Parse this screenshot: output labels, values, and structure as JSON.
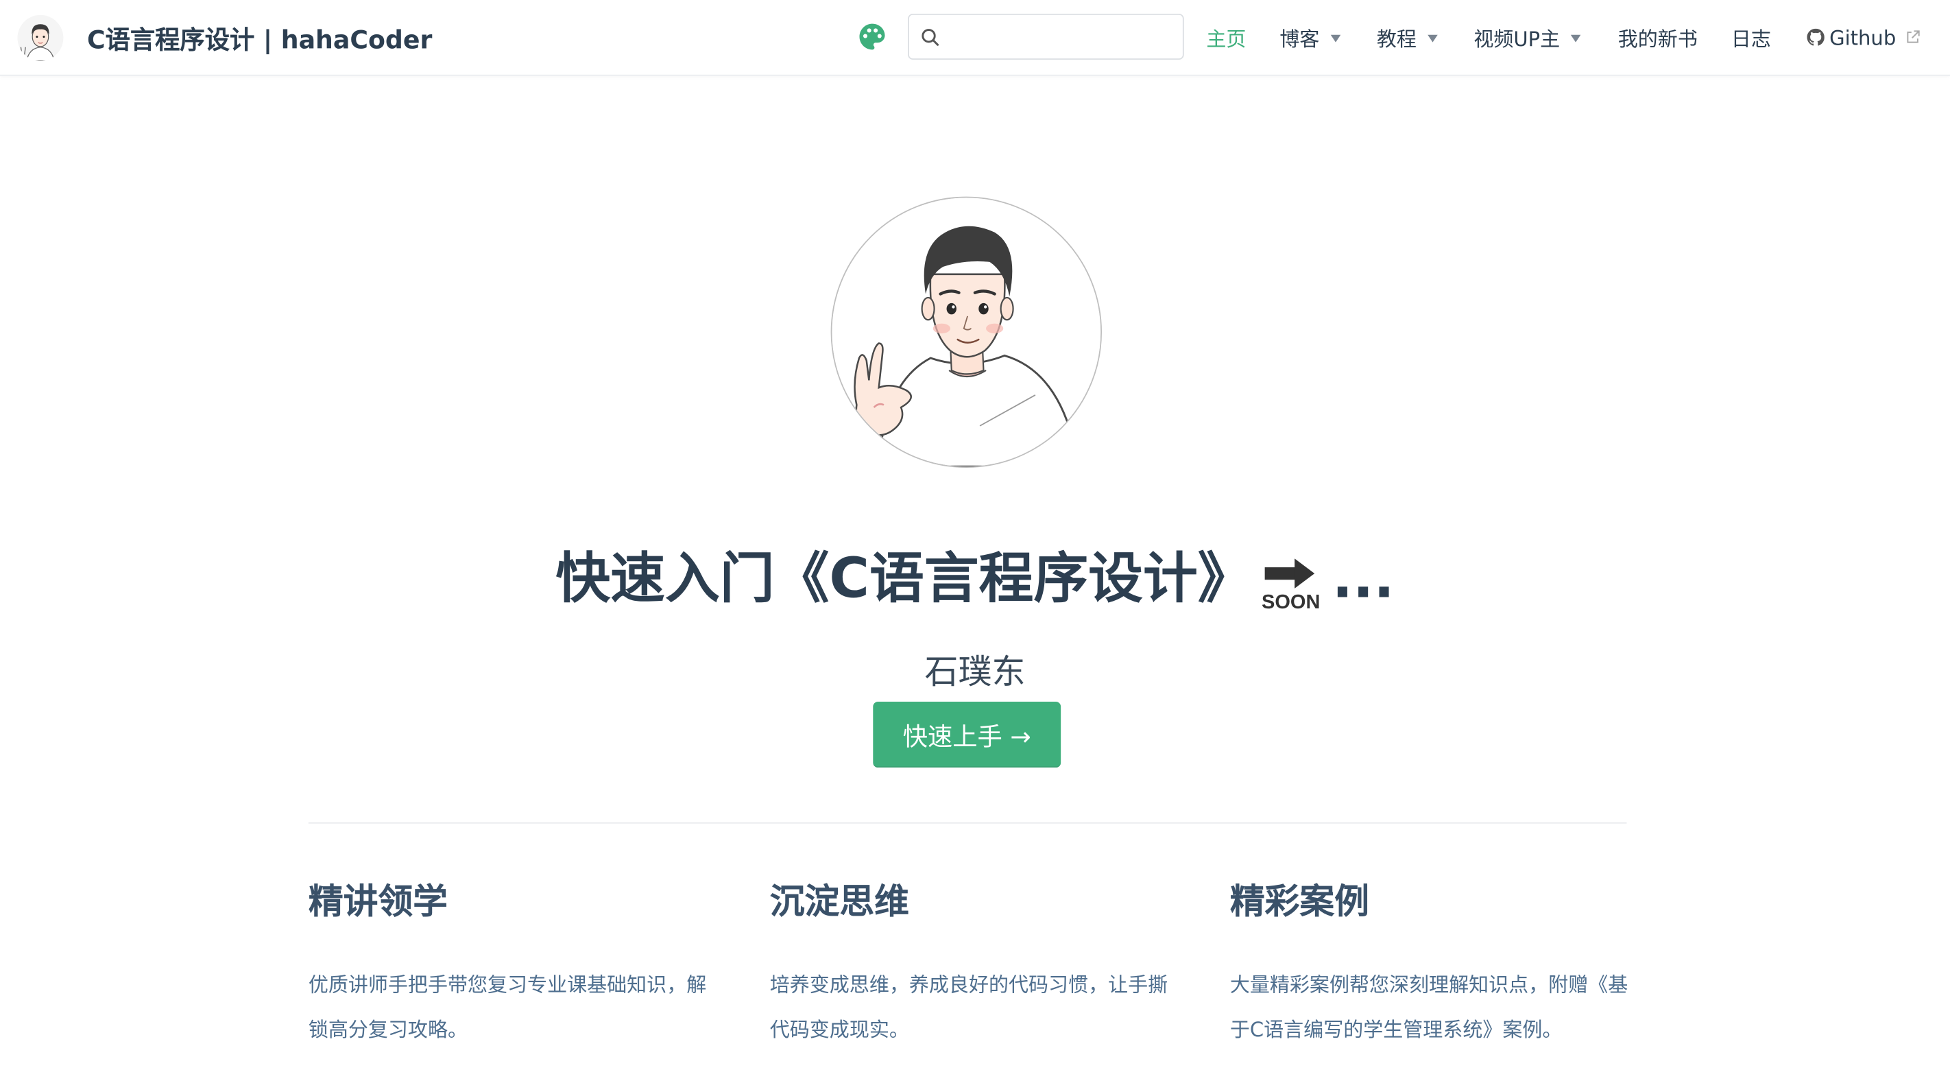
{
  "site": {
    "title": "C语言程序设计 | hahaCoder",
    "accent_color": "#3eaf7c"
  },
  "search": {
    "value": "",
    "placeholder": ""
  },
  "nav": {
    "items": [
      {
        "label": "主页",
        "active": true
      },
      {
        "label": "博客",
        "dropdown": true
      },
      {
        "label": "教程",
        "dropdown": true
      },
      {
        "label": "视频UP主",
        "dropdown": true
      },
      {
        "label": "我的新书"
      },
      {
        "label": "日志"
      },
      {
        "label": "Github",
        "icon": "github-icon",
        "external": true
      }
    ]
  },
  "hero": {
    "title_main": "快速入门《C语言程序设计》",
    "title_badge": "SOON",
    "title_badge_icon": "soon-arrow-emoji",
    "title_tail": "...",
    "description": "石璞东",
    "action_label": "快速上手 →"
  },
  "features": [
    {
      "title": "精讲领学",
      "details": "优质讲师手把手带您复习专业课基础知识，解锁高分复习攻略。"
    },
    {
      "title": "沉淀思维",
      "details": "培养变成思维，养成良好的代码习惯，让手撕代码变成现实。"
    },
    {
      "title": "精彩案例",
      "details": "大量精彩案例帮您深刻理解知识点，附赠《基于C语言编写的学生管理系统》案例。"
    }
  ]
}
